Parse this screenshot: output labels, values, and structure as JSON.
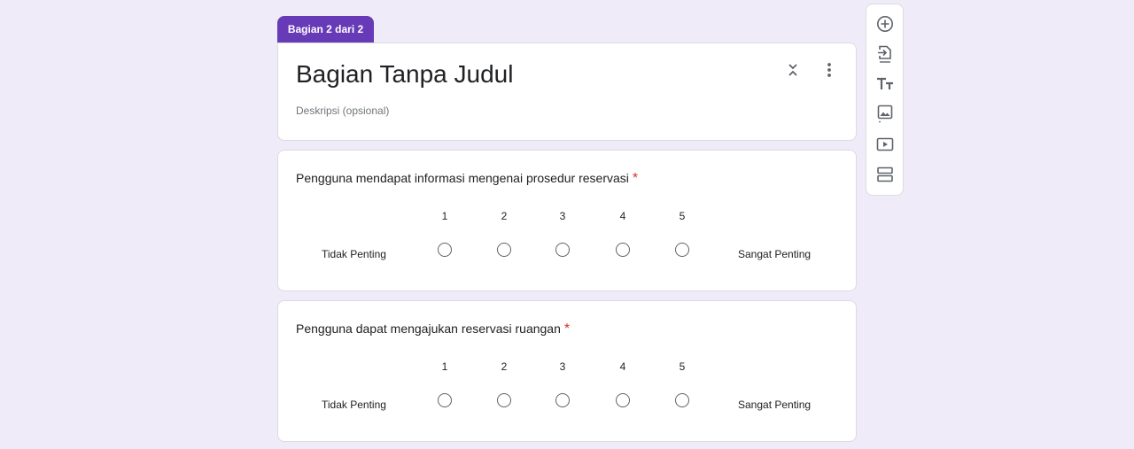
{
  "section_tab": "Bagian 2 dari 2",
  "header": {
    "title": "Bagian Tanpa Judul",
    "description": "Deskripsi (opsional)"
  },
  "questions": [
    {
      "title": "Pengguna mendapat informasi mengenai prosedur reservasi",
      "required_mark": "*",
      "scale": [
        "1",
        "2",
        "3",
        "4",
        "5"
      ],
      "low_label": "Tidak Penting",
      "high_label": "Sangat Penting"
    },
    {
      "title": "Pengguna dapat mengajukan reservasi ruangan",
      "required_mark": "*",
      "scale": [
        "1",
        "2",
        "3",
        "4",
        "5"
      ],
      "low_label": "Tidak Penting",
      "high_label": "Sangat Penting"
    }
  ],
  "toolbar": {
    "icons": [
      "add-question-icon",
      "import-questions-icon",
      "add-title-icon",
      "add-image-icon",
      "add-video-icon",
      "add-section-icon"
    ]
  },
  "colors": {
    "accent": "#673ab7",
    "background": "#f0ebf8",
    "required": "#d93025"
  }
}
